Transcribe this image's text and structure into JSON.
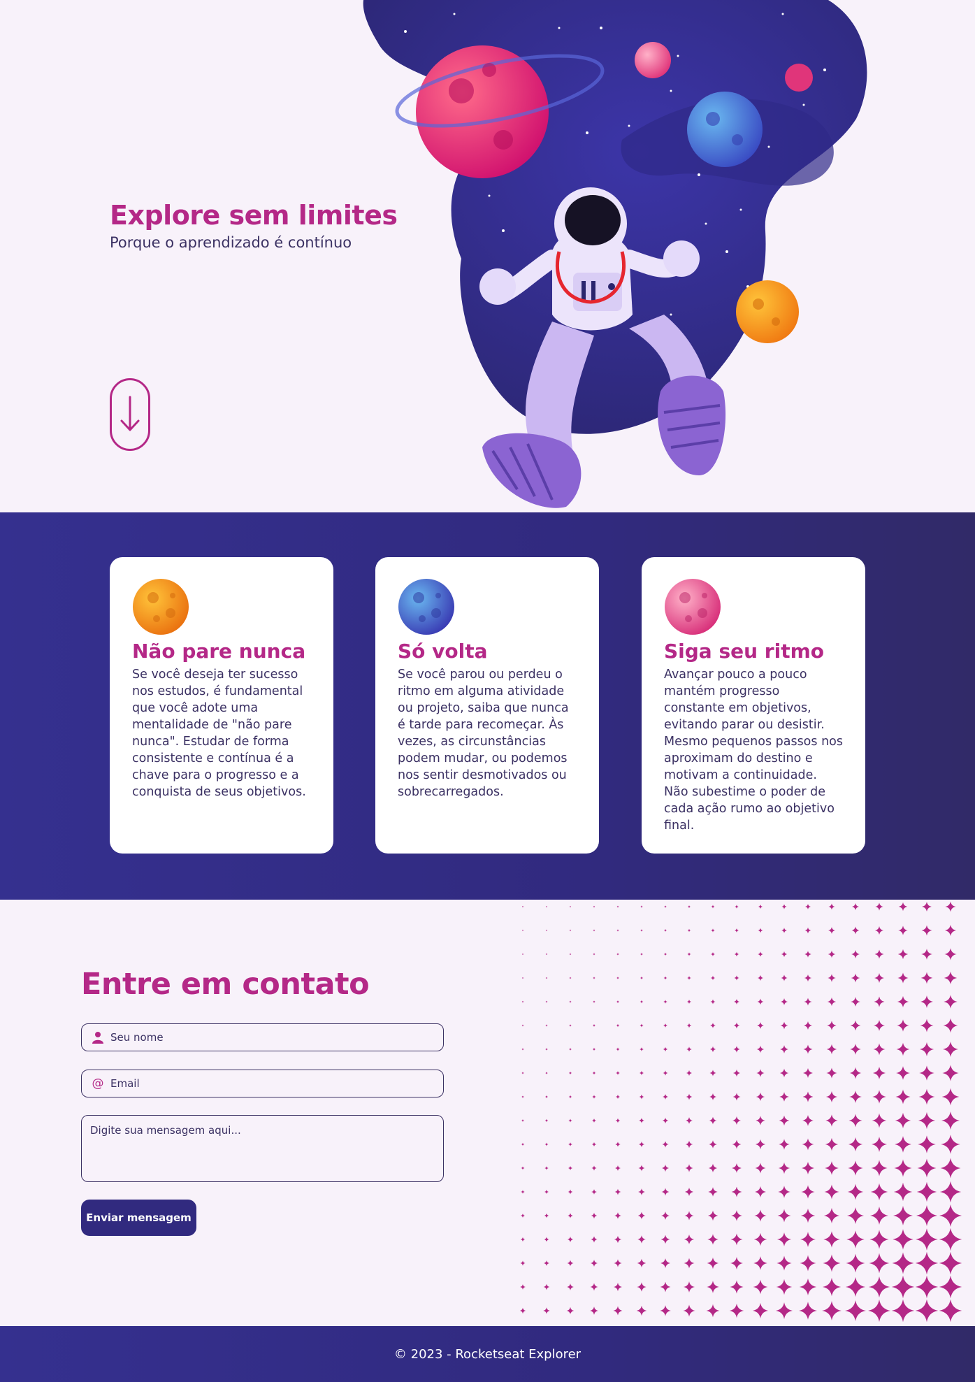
{
  "hero": {
    "title": "Explore sem limites",
    "subtitle": "Porque o aprendizado é contínuo",
    "scroll_icon": "arrow-down-icon",
    "illustration": "astronaut-in-space-illustration"
  },
  "cards": [
    {
      "planet_icon": "orange-planet-icon",
      "title": "Não pare nunca",
      "text": "Se você deseja ter sucesso nos estudos, é fundamental que você adote uma mentalidade de \"não pare nunca\". Estudar de forma consistente e contínua é a chave para o progresso e a conquista de seus objetivos."
    },
    {
      "planet_icon": "blue-planet-icon",
      "title": "Só volta",
      "text": "Se você parou ou perdeu o ritmo em alguma atividade ou projeto, saiba que nunca é tarde para recomeçar. Às vezes, as circunstâncias podem mudar, ou podemos nos sentir desmotivados ou sobrecarregados."
    },
    {
      "planet_icon": "pink-planet-icon",
      "title": "Siga seu ritmo",
      "text": "Avançar pouco a pouco mantém progresso constante em objetivos, evitando parar ou desistir. Mesmo pequenos passos nos aproximam do destino e motivam a continuidade. Não subestime o poder de cada ação rumo ao objetivo final."
    }
  ],
  "contact": {
    "title": "Entre em contato",
    "name_placeholder": "Seu nome",
    "email_placeholder": "Email",
    "message_placeholder": "Digite sua mensagem aqui...",
    "submit_label": "Enviar mensagem"
  },
  "footer": {
    "copyright": "© 2023 - Rocketseat Explorer"
  },
  "colors": {
    "accent": "#b42887",
    "primary": "#312a7f",
    "background": "#f8f2fa",
    "text": "#3b3163"
  }
}
